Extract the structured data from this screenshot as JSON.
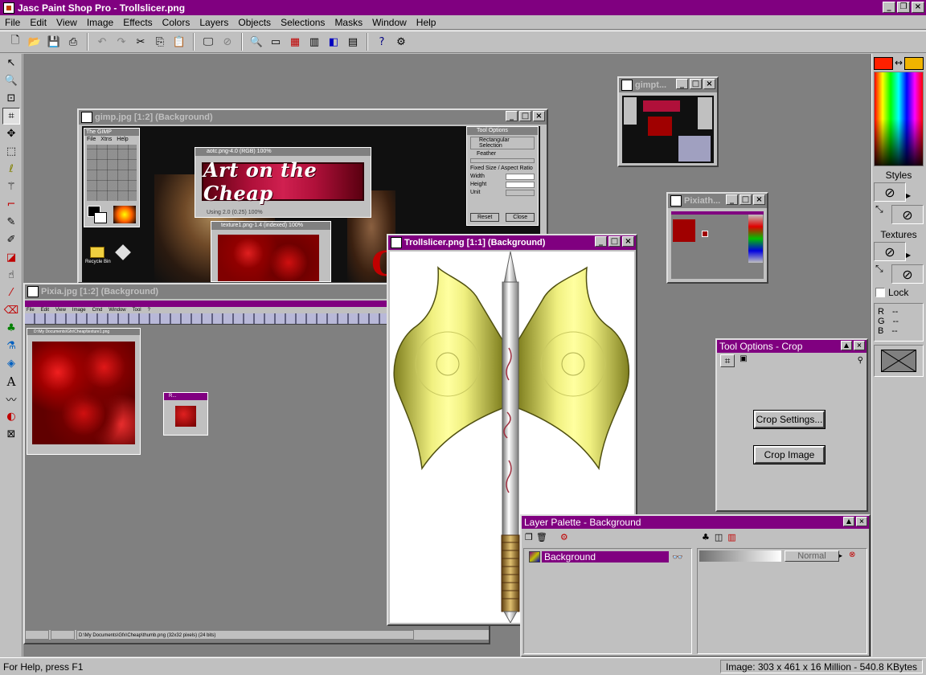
{
  "app": {
    "title": "Jasc Paint Shop Pro - Trollslicer.png"
  },
  "menu": [
    "File",
    "Edit",
    "View",
    "Image",
    "Effects",
    "Colors",
    "Layers",
    "Objects",
    "Selections",
    "Masks",
    "Window",
    "Help"
  ],
  "windows": {
    "gimp": {
      "title": "gimp.jpg [1:2] (Background)"
    },
    "gimp_thumb": {
      "title": "gimpt..."
    },
    "pixia_thumb": {
      "title": "Pixiath..."
    },
    "pixia": {
      "title": "Pixia.jpg [1:2] (Background)"
    },
    "troll": {
      "title": "Trollslicer.png [1:1] (Background)"
    }
  },
  "gimp_inner": {
    "toolbox_title": "The GIMP",
    "menu": [
      "File",
      "Xtns",
      "Help"
    ],
    "banner_title": "aotc.png-4.0 (RGB) 100%",
    "banner_text": "Art on the Cheap",
    "banner_status": "Using 2.0 (0.25) 100%",
    "texture_title": "texture1.png-1.4 (indexed) 100%",
    "tooloptions_title": "Tool Options",
    "tooloptions_mode": "Rectangular Selection",
    "tooloptions_feather": "Feather",
    "tooloptions_fixed": "Fixed Size / Aspect Ratio",
    "tooloptions_width": "Width",
    "tooloptions_height": "Height",
    "tooloptions_unit": "Unit",
    "tooloptions_reset": "Reset",
    "tooloptions_close": "Close",
    "desktop_label": "Recycle Bin"
  },
  "pixia_inner": {
    "path_title": "D:\\My Documents\\Gfx\\Cheap\\texture1.png",
    "menu": [
      "File",
      "Edit",
      "View",
      "Image",
      "Cmd",
      "Window",
      "Tool",
      "?"
    ],
    "status_path": "D:\\My Documents\\Gfx\\Cheap\\thumb.png (32x32 pixels) (24 bits)",
    "small_title": "R..."
  },
  "tool_options": {
    "title": "Tool Options - Crop",
    "crop_settings": "Crop Settings...",
    "crop_image": "Crop Image"
  },
  "layer_palette": {
    "title": "Layer Palette - Background",
    "layer_name": "Background",
    "blend_mode": "Normal"
  },
  "right_panel": {
    "styles_label": "Styles",
    "textures_label": "Textures",
    "lock_label": "Lock",
    "r_label": "R",
    "g_label": "G",
    "b_label": "B",
    "r_value": "--",
    "g_value": "--",
    "b_value": "--",
    "foreground_color": "#ff2000",
    "background_color": "#f0b400"
  },
  "status": {
    "help": "For Help, press F1",
    "image_info": "Image:  303 x 461 x 16 Million - 540.8 KBytes"
  }
}
